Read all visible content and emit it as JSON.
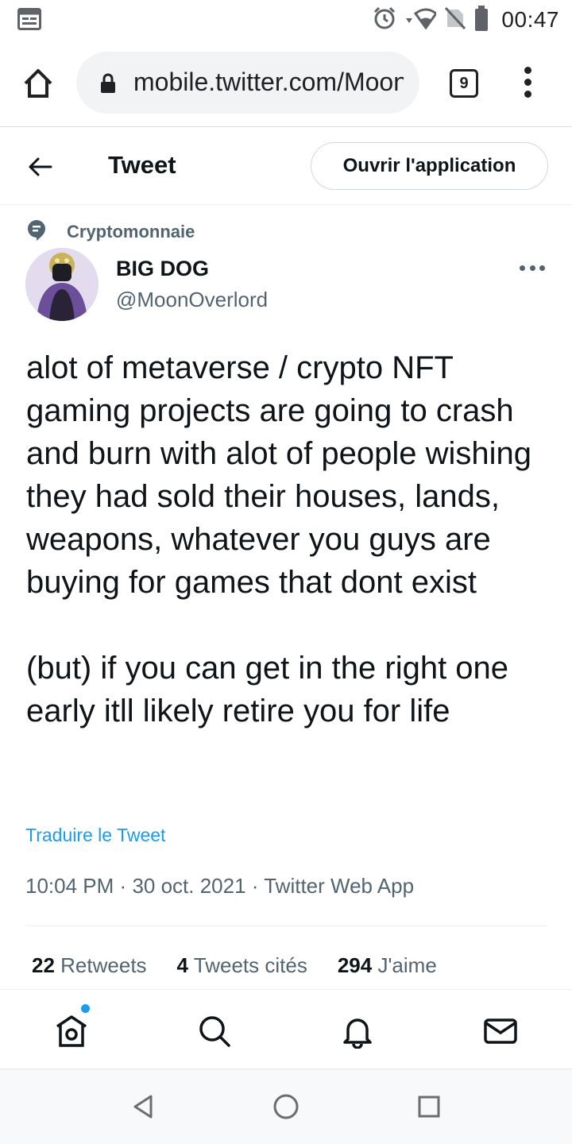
{
  "status_bar": {
    "time": "00:47",
    "icons": [
      "calendar-icon",
      "alarm-icon",
      "wifi-icon",
      "no-sim-icon",
      "battery-icon"
    ]
  },
  "browser": {
    "url": "mobile.twitter.com/MoonOverlord",
    "tab_count": "9",
    "icons": [
      "home-icon",
      "lock-icon",
      "more-vert-icon"
    ]
  },
  "header": {
    "title": "Tweet",
    "open_app_label": "Ouvrir l'application"
  },
  "tweet": {
    "topic": "Cryptomonnaie",
    "author_name": "BIG DOG",
    "author_handle": "@MoonOverlord",
    "paragraph_1": "alot of metaverse / crypto NFT gaming projects are going to crash and burn with alot of people wishing they had sold their houses, lands, weapons, whatever you guys are buying for games that dont exist",
    "paragraph_2": "(but) if you can get in the right one early itll likely retire you for life",
    "translate_label": "Traduire le Tweet",
    "time": "10:04 PM",
    "date": "30 oct. 2021",
    "source": "Twitter Web App",
    "separator": "·"
  },
  "stats": {
    "retweets_count": "22",
    "retweets_label": "Retweets",
    "quotes_count": "4",
    "quotes_label": "Tweets cités",
    "likes_count": "294",
    "likes_label": "J'aime"
  },
  "colors": {
    "accent": "#1d9bf0",
    "text_primary": "#0f1419",
    "text_secondary": "#536471"
  }
}
